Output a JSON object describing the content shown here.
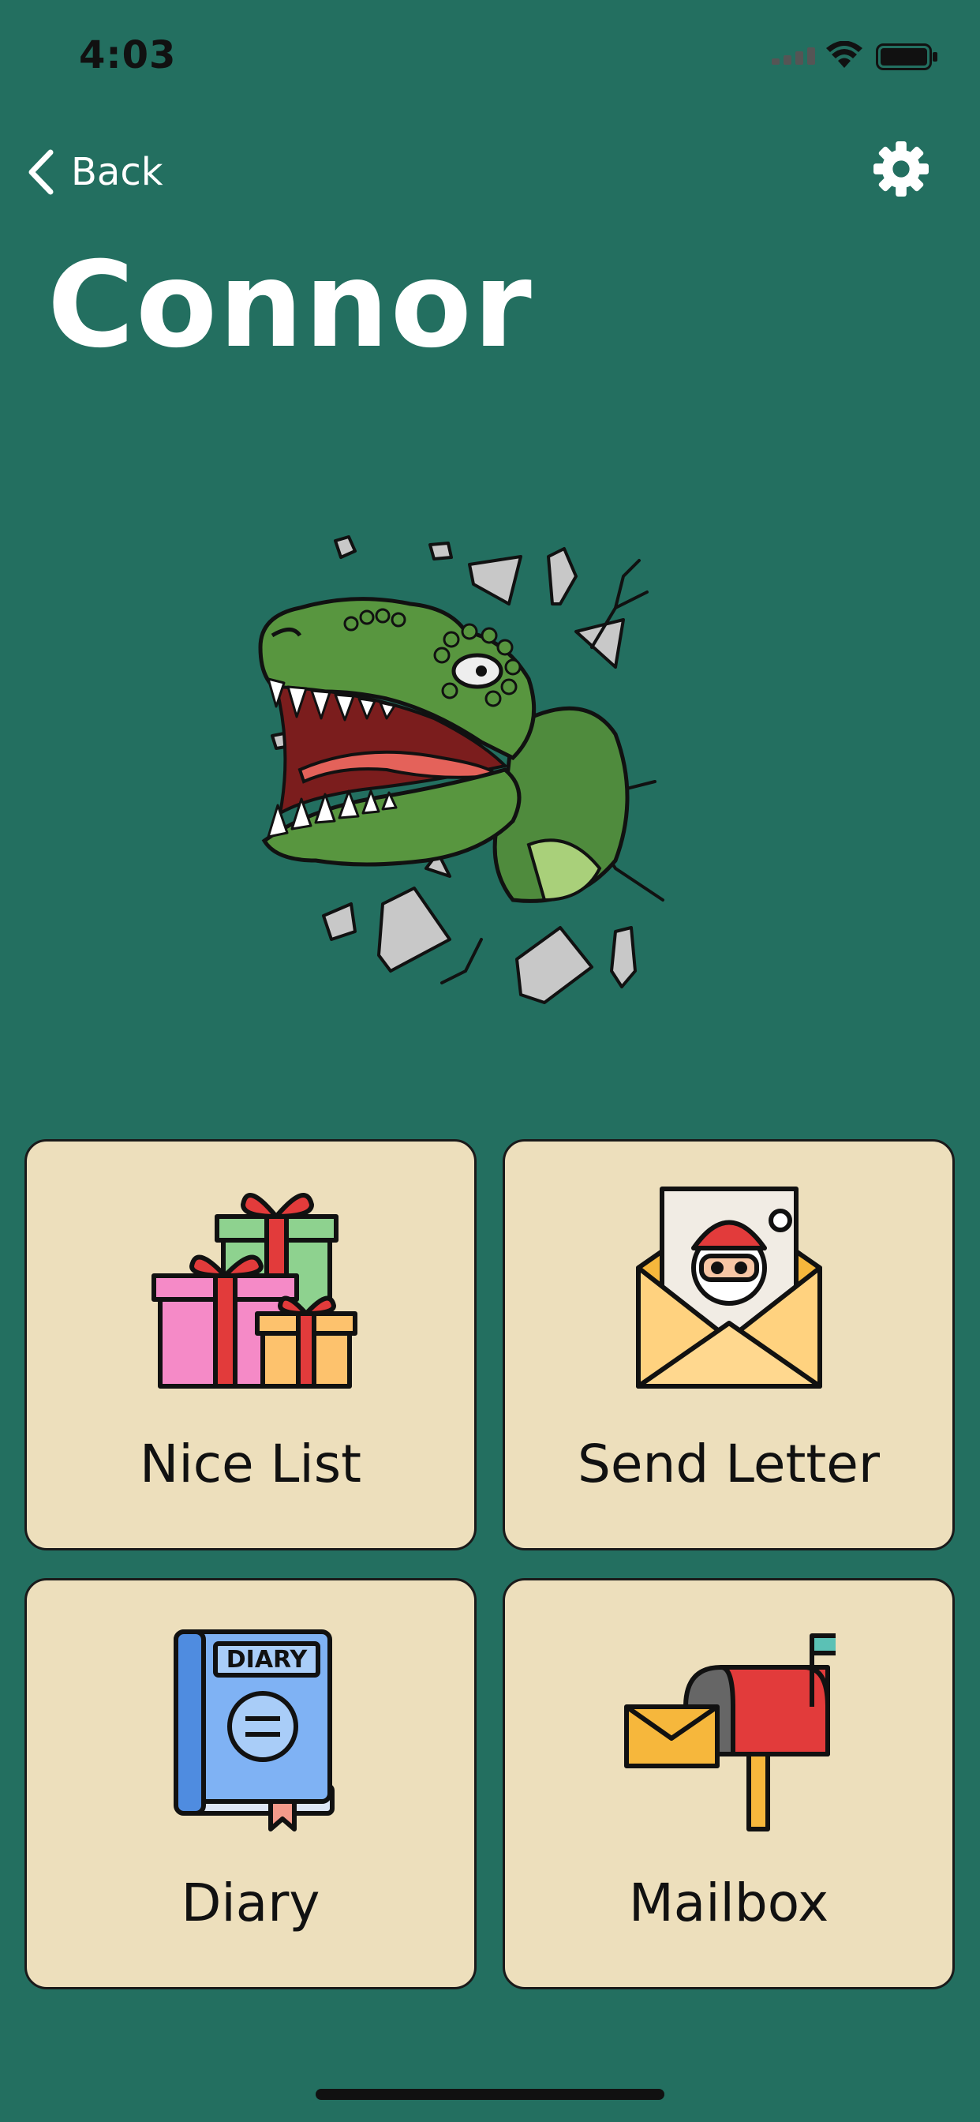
{
  "status_bar": {
    "time": "4:03"
  },
  "nav": {
    "back_label": "Back"
  },
  "profile": {
    "name": "Connor"
  },
  "tiles": [
    {
      "label": "Nice List",
      "icon": "gifts-icon"
    },
    {
      "label": "Send Letter",
      "icon": "santa-letter-icon"
    },
    {
      "label": "Diary",
      "icon": "diary-icon"
    },
    {
      "label": "Mailbox",
      "icon": "mailbox-icon"
    }
  ],
  "colors": {
    "background": "#236f60",
    "tile": "#eddfbc",
    "text_dark": "#111111"
  }
}
